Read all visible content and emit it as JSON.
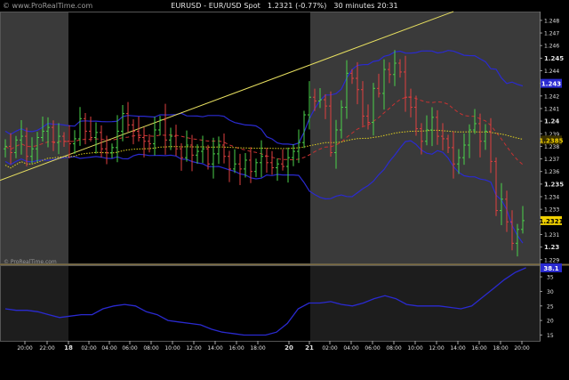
{
  "header": {
    "watermark": "© www.ProRealTime.com",
    "symbol": "EURUSD - EUR/USD Spot",
    "price_change": "1.2321 (-0.77%)",
    "timeframe": "30 minutes",
    "clock": "20:31"
  },
  "footer_credit": "© ProRealTime.com",
  "colors": {
    "background": "#000000",
    "session_shade": "#3a3a3a",
    "bull_bar": "#4bd24b",
    "bear_bar": "#e04040",
    "bollinger": "#2a2ad0",
    "moving_avg_red": "#c83232",
    "moving_avg_yellow": "#e0d020",
    "trendline": "#e8e060",
    "last_price_tag": "#f0d000",
    "indicator_line": "#2a2ad0"
  },
  "chart_data": {
    "type": "line",
    "title": "EURUSD - EUR/USD Spot",
    "series": [
      {
        "name": "Price (30m OHLC bars)",
        "type": "ohlc",
        "approx_close": [
          1.238,
          1.2375,
          1.2385,
          1.2388,
          1.2372,
          1.2378,
          1.2387,
          1.2392,
          1.2395,
          1.2383,
          1.2388,
          1.2384,
          1.2382,
          1.2386,
          1.2402,
          1.2392,
          1.2387,
          1.2391,
          1.2378,
          1.2375,
          1.2379,
          1.2392,
          1.2406,
          1.2397,
          1.2392,
          1.2387,
          1.2384,
          1.2382,
          1.2393,
          1.2401,
          1.2385,
          1.2388,
          1.2378,
          1.2371,
          1.2381,
          1.2373,
          1.2376,
          1.2378,
          1.2366,
          1.2374,
          1.2381,
          1.2372,
          1.2362,
          1.2366,
          1.2362,
          1.2369,
          1.236,
          1.2367,
          1.2372,
          1.2367,
          1.2363,
          1.2366,
          1.2364,
          1.2371,
          1.2376,
          1.2383,
          1.2405,
          1.2419,
          1.2416,
          1.2417,
          1.2412,
          1.2375,
          1.2393,
          1.2411,
          1.2438,
          1.2434,
          1.2425,
          1.2404,
          1.2399,
          1.2426,
          1.2422,
          1.2441,
          1.2437,
          1.2446,
          1.2439,
          1.2419,
          1.2411,
          1.2394,
          1.2384,
          1.2393,
          1.2403,
          1.2388,
          1.2386,
          1.2379,
          1.2366,
          1.2371,
          1.2381,
          1.2393,
          1.2398,
          1.2384,
          1.2392,
          1.2368,
          1.2329,
          1.2338,
          1.232,
          1.2303,
          1.2314,
          1.2321
        ]
      },
      {
        "name": "Bollinger upper",
        "type": "line"
      },
      {
        "name": "Bollinger lower",
        "type": "line"
      },
      {
        "name": "Moving average (red dashed)",
        "type": "line"
      },
      {
        "name": "Moving average (yellow dotted)",
        "type": "line"
      },
      {
        "name": "Trendline",
        "type": "line"
      }
    ],
    "xticks": [
      "20:00",
      "22:00",
      "18",
      "02:00",
      "04:00",
      "06:00",
      "08:00",
      "10:00",
      "12:00",
      "14:00",
      "16:00",
      "18:00",
      "20",
      "21",
      "02:00",
      "04:00",
      "06:00",
      "08:00",
      "10:00",
      "12:00",
      "14:00",
      "16:00",
      "18:00",
      "20:00"
    ],
    "bold_ticks": [
      "18",
      "20",
      "21"
    ],
    "yticks": [
      "1.248",
      "1.247",
      "1.246",
      "1.245",
      "1.244",
      "1.243",
      "1.242",
      "1.241",
      "1.24",
      "1.239",
      "1.238",
      "1.237",
      "1.236",
      "1.235",
      "1.234",
      "1.233",
      "1.232",
      "1.231",
      "1.23",
      "1.229"
    ],
    "bold_yticks": [
      "1.245",
      "1.24",
      "1.235",
      "1.23"
    ],
    "ylim": [
      1.2287,
      1.2487
    ],
    "last_price": "1.2321",
    "ma_tag": "1.2385",
    "trend_tag": "1.243",
    "sub_indicator": {
      "yticks": [
        "35",
        "30",
        "25",
        "20",
        "15"
      ],
      "ylim": [
        13,
        39
      ],
      "last_tag": "38.1",
      "values": [
        24,
        23.5,
        23.5,
        23,
        22,
        21,
        21.5,
        22,
        22,
        24,
        25,
        25.5,
        25,
        23,
        22,
        20,
        19.5,
        19,
        18.5,
        17,
        16,
        15.5,
        15,
        15,
        15,
        16,
        19,
        24,
        26,
        26,
        26.5,
        25.5,
        25,
        26,
        27.5,
        28.5,
        27.5,
        25.5,
        25,
        25,
        25,
        24.5,
        24,
        25,
        28,
        31,
        34,
        36.5,
        38.1
      ]
    }
  }
}
